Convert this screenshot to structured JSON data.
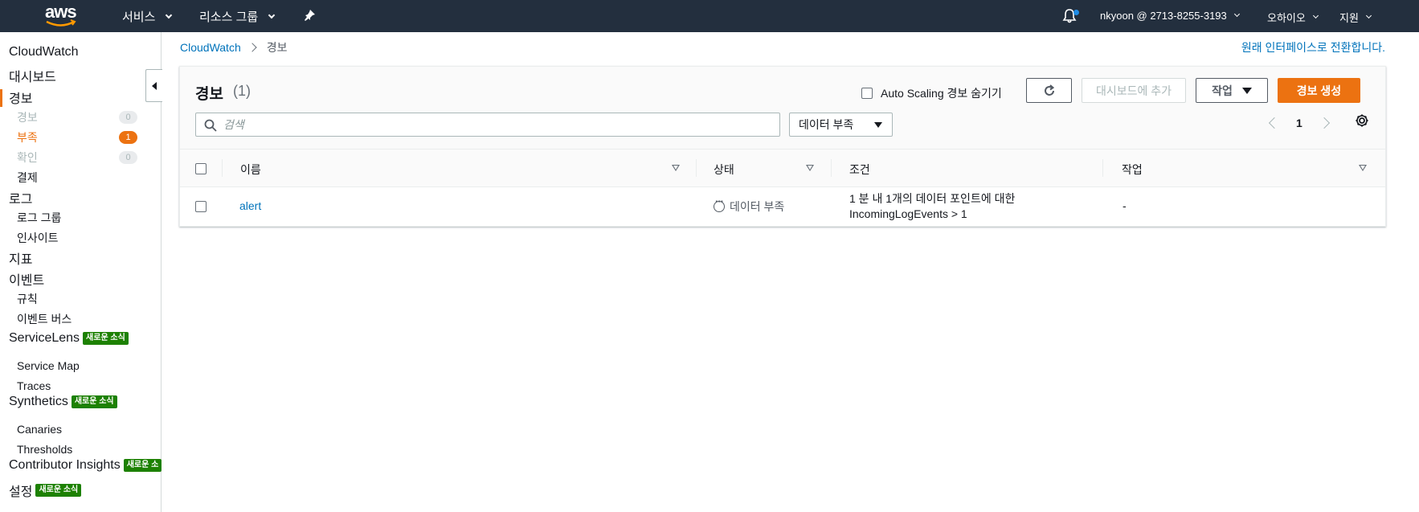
{
  "topnav": {
    "logo_text": "aws",
    "services": "서비스",
    "resource_groups": "리소스 그룹",
    "account": "nkyoon @ 2713-8255-3193",
    "region": "오하이오",
    "support": "지원"
  },
  "sidebar": {
    "cloudwatch": "CloudWatch",
    "dashboards": "대시보드",
    "alarms": "경보",
    "alarm_sub": [
      {
        "label": "경보",
        "count": "0"
      },
      {
        "label": "부족",
        "count": "1"
      },
      {
        "label": "확인",
        "count": "0"
      }
    ],
    "billing": "결제",
    "logs": "로그",
    "log_groups": "로그 그룹",
    "insights": "인사이트",
    "metrics": "지표",
    "events": "이벤트",
    "rules": "규칙",
    "event_buses": "이벤트 버스",
    "servicelens": "ServiceLens",
    "service_map": "Service Map",
    "traces": "Traces",
    "synthetics": "Synthetics",
    "canaries": "Canaries",
    "thresholds": "Thresholds",
    "contributor_insights": "Contributor Insights",
    "settings": "설정",
    "new_badge": "새로운 소식",
    "new_badge_cut": "새로운 소"
  },
  "breadcrumb": {
    "root": "CloudWatch",
    "current": "경보"
  },
  "switch_link": "원래 인터페이스로 전환합니다.",
  "panel": {
    "title": "경보",
    "count": "(1)",
    "hide_asg": "Auto Scaling 경보 숨기기",
    "add_dashboard": "대시보드에 추가",
    "actions": "작업",
    "create_alarm": "경보 생성",
    "search_placeholder": "검색",
    "state_filter": "데이터 부족",
    "page": "1"
  },
  "table": {
    "columns": [
      "이름",
      "상태",
      "조건",
      "작업"
    ],
    "rows": [
      {
        "name": "alert",
        "state": "데이터 부족",
        "condition_line1": "1 분 내 1개의 데이터 포인트에 대한",
        "condition_line2": "IncomingLogEvents > 1",
        "actions": "-"
      }
    ]
  }
}
